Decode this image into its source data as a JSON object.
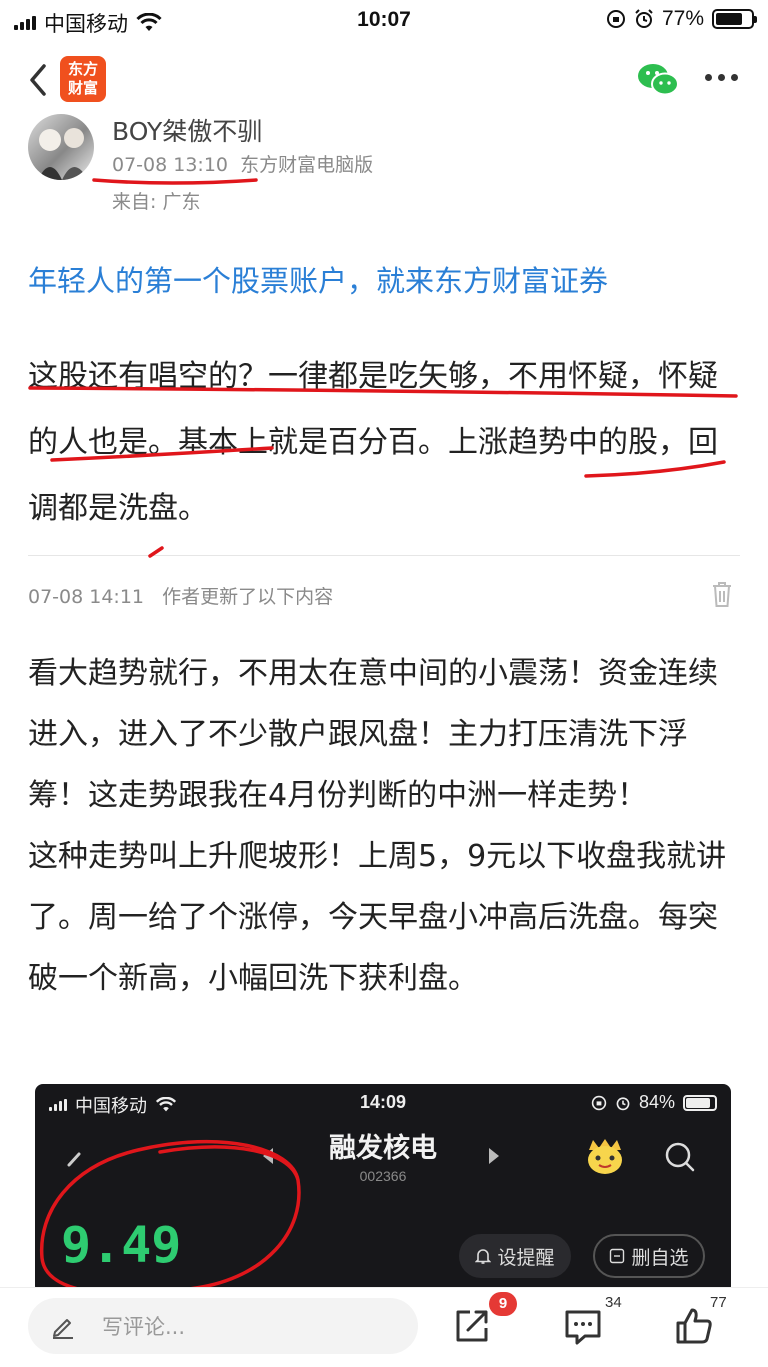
{
  "status_bar": {
    "carrier": "中国移动",
    "time": "10:07",
    "battery": "77%",
    "battery_level": 0.77
  },
  "nav": {
    "logo_line1": "东方",
    "logo_line2": "财富"
  },
  "author": {
    "name": "BOY桀傲不驯",
    "date": "07-08 13:10",
    "source": "东方财富电脑版",
    "location": "来自: 广东"
  },
  "ad_link": "年轻人的第一个股票账户，就来东方财富证券",
  "post_text": "这股还有唱空的？一律都是吃矢够，不用怀疑，怀疑的人也是。基本上就是百分百。上涨趋势中的股，回调都是洗盘。",
  "update": {
    "date": "07-08 14:11",
    "label": "作者更新了以下内容",
    "text_1": "看大趋势就行，不用太在意中间的小震荡！资金连续进入，进入了不少散户跟风盘！主力打压清洗下浮筹！这走势跟我在4月份判断的中洲一样走势！",
    "text_2": "这种走势叫上升爬坡形！上周5，9元以下收盘我就讲了。周一给了个涨停，今天早盘小冲高后洗盘。每突破一个新高，小幅回洗下获利盘。"
  },
  "embedded_screenshot": {
    "carrier": "中国移动",
    "time": "14:09",
    "battery": "84%",
    "battery_level": 0.84,
    "stock_name": "融发核电",
    "stock_code": "002366",
    "price": "9.49",
    "remind_label": "设提醒",
    "remove_label": "删自选",
    "price_color": "#2ecc71"
  },
  "bottom_bar": {
    "comment_placeholder": "写评论...",
    "share_badge": "9",
    "comment_count": "34",
    "like_count": "77"
  },
  "colors": {
    "link_blue": "#2a7fd6",
    "brand_orange": "#f0501e",
    "annotation_red": "#e0161b"
  }
}
